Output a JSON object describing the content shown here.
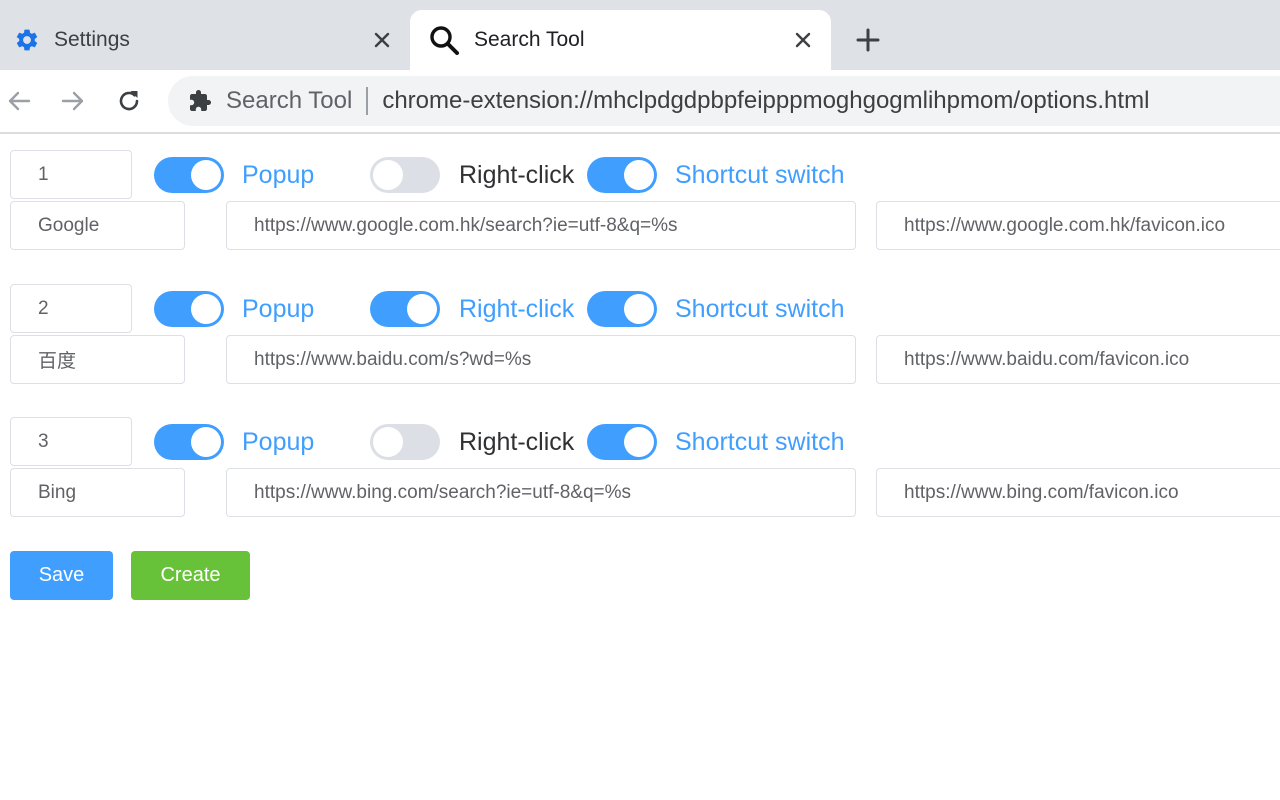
{
  "browser": {
    "tabs": [
      {
        "title": "Settings",
        "icon": "gear-icon",
        "active": false
      },
      {
        "title": "Search Tool",
        "icon": "search-icon",
        "active": true
      }
    ],
    "new_tab_icon": "plus-icon",
    "omnibox": {
      "site_name": "Search Tool",
      "url": "chrome-extension://mhclpdgdpbpfeipppmoghgogmlihpmom/options.html",
      "icon": "puzzle-icon"
    }
  },
  "labels": {
    "popup": "Popup",
    "right_click": "Right-click",
    "shortcut": "Shortcut switch"
  },
  "entries": [
    {
      "order": "1",
      "name": "Google",
      "url": "https://www.google.com.hk/search?ie=utf-8&q=%s",
      "icon_url": "https://www.google.com.hk/favicon.ico",
      "popup": true,
      "right_click": false,
      "shortcut": true
    },
    {
      "order": "2",
      "name": "百度",
      "url": "https://www.baidu.com/s?wd=%s",
      "icon_url": "https://www.baidu.com/favicon.ico",
      "popup": true,
      "right_click": true,
      "shortcut": true
    },
    {
      "order": "3",
      "name": "Bing",
      "url": "https://www.bing.com/search?ie=utf-8&q=%s",
      "icon_url": "https://www.bing.com/favicon.ico",
      "popup": true,
      "right_click": false,
      "shortcut": true
    }
  ],
  "buttons": {
    "save": "Save",
    "create": "Create"
  },
  "colors": {
    "primary": "#409eff",
    "success": "#67c23a",
    "switch_off": "#dcdfe6",
    "tab_icon_blue": "#1a73e8"
  }
}
